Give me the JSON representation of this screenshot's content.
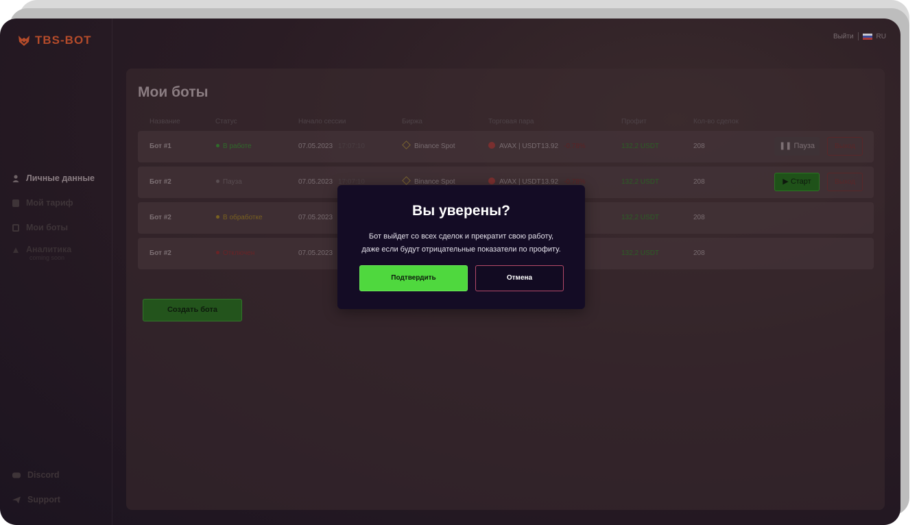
{
  "brand": {
    "name": "TBS-BOT",
    "color": "#b44b2a"
  },
  "topbar": {
    "logout": "Выйти",
    "language": "RU"
  },
  "sidebar": {
    "items": [
      {
        "label": "Личные данные",
        "icon": "user-icon",
        "active": true
      },
      {
        "label": "Мой тариф",
        "icon": "tariff-icon",
        "active": false
      },
      {
        "label": "Мои боты",
        "icon": "bots-icon",
        "active": false
      },
      {
        "label": "Аналитика",
        "sub": "coming soon",
        "icon": "analytics-icon",
        "active": false
      }
    ],
    "footer": [
      {
        "label": "Discord",
        "icon": "discord-icon"
      },
      {
        "label": "Support",
        "icon": "telegram-icon"
      }
    ]
  },
  "page": {
    "title": "Мои боты"
  },
  "table": {
    "headers": [
      "Название",
      "Статус",
      "Начало сессии",
      "Биржа",
      "Торговая пара",
      "Профит",
      "Кол-во сделок"
    ],
    "rows": [
      {
        "name": "Бот #1",
        "status": "В работе",
        "status_color": "#2f6b2a",
        "date": "07.05.2023",
        "time": "17:07:10",
        "exchange": "Binance Spot",
        "pair": "AVAX | USDT",
        "price": "13.92",
        "change": "-0.78%",
        "profit": "132,2 USDT",
        "deals": "208",
        "action": "Пауза",
        "exit": "Выход"
      },
      {
        "name": "Бот #2",
        "status": "Пауза",
        "status_color": "#5a4e52",
        "date": "07.05.2023",
        "time": "17:07:10",
        "exchange": "Binance Spot",
        "pair": "AVAX | USDT",
        "price": "13.92",
        "change": "-0.78%",
        "profit": "132,2 USDT",
        "deals": "208",
        "action": "Старт",
        "exit": "Выход"
      },
      {
        "name": "Бот #2",
        "status": "В обработке",
        "status_color": "#7a6120",
        "date": "07.05.2023",
        "profit": "132,2 USDT",
        "deals": "208"
      },
      {
        "name": "Бот #2",
        "status": "Отключен",
        "status_color": "#6a2326",
        "date": "07.05.2023",
        "profit": "132,2 USDT",
        "deals": "208"
      }
    ]
  },
  "create_button": "Создать бота",
  "modal": {
    "title": "Вы уверены?",
    "line1": "Бот выйдет со всех сделок и прекратит свою работу,",
    "line2": "даже если будут отрицательные показатели по профиту.",
    "confirm": "Подтвердить",
    "cancel": "Отмена"
  },
  "colors": {
    "accent_green": "#4fd83e",
    "modal_bg": "#140c25",
    "cancel_border": "#b64a6a"
  }
}
